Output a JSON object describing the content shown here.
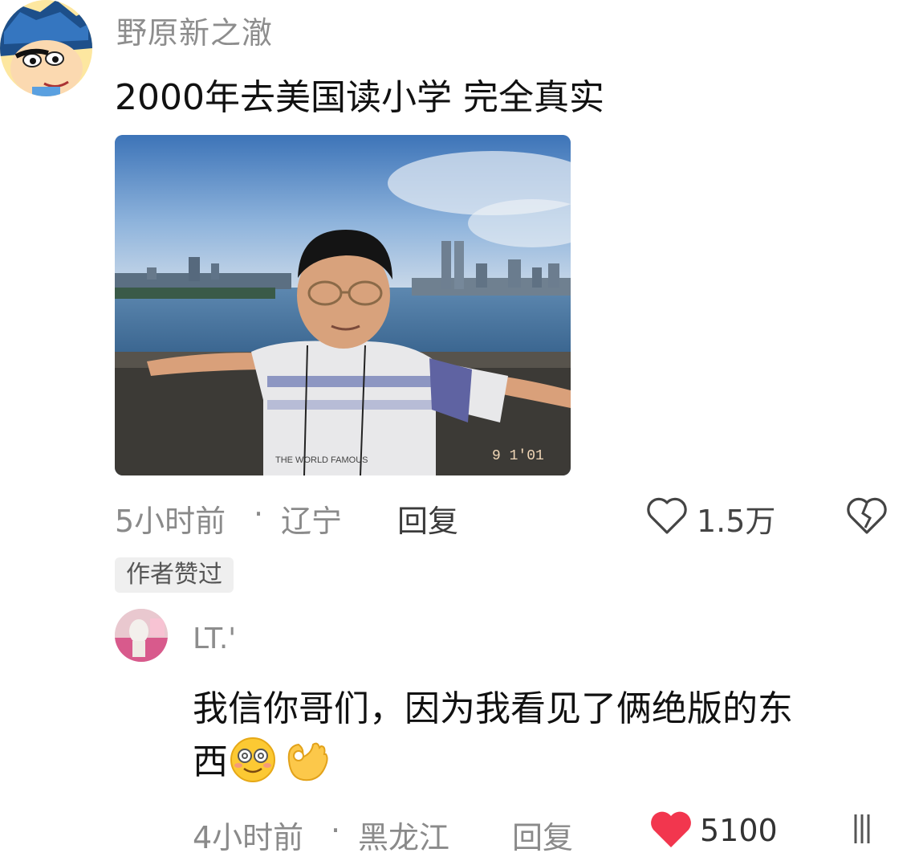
{
  "comment": {
    "username": "野原新之澈",
    "text": "2000年去美国读小学 完全真实",
    "photo_stamp": "9 1'01",
    "photo_shirt_text": "THE WORLD FAMOUS",
    "time": "5小时前",
    "separator": "·",
    "location": "辽宁",
    "reply_label": "回复",
    "like_count": "1.5万",
    "author_liked_badge": "作者赞过"
  },
  "reply": {
    "username": "LT.'",
    "text_line1": "我信你哥们，因为我看见了俩绝版的东",
    "text_line2": "西",
    "time": "4小时前",
    "separator": "·",
    "location": "黑龙江",
    "reply_label": "回复",
    "like_count": "5100"
  },
  "icons": {
    "avatar1": "cartoon-avatar",
    "like": "heart-outline-icon",
    "dislike": "broken-heart-icon",
    "liked": "heart-filled-icon",
    "emoji1": "dizzy-smile-emoji",
    "emoji2": "ok-hand-emoji"
  },
  "colors": {
    "liked_heart": "#f2364e",
    "muted_text": "#8a8a8a"
  }
}
